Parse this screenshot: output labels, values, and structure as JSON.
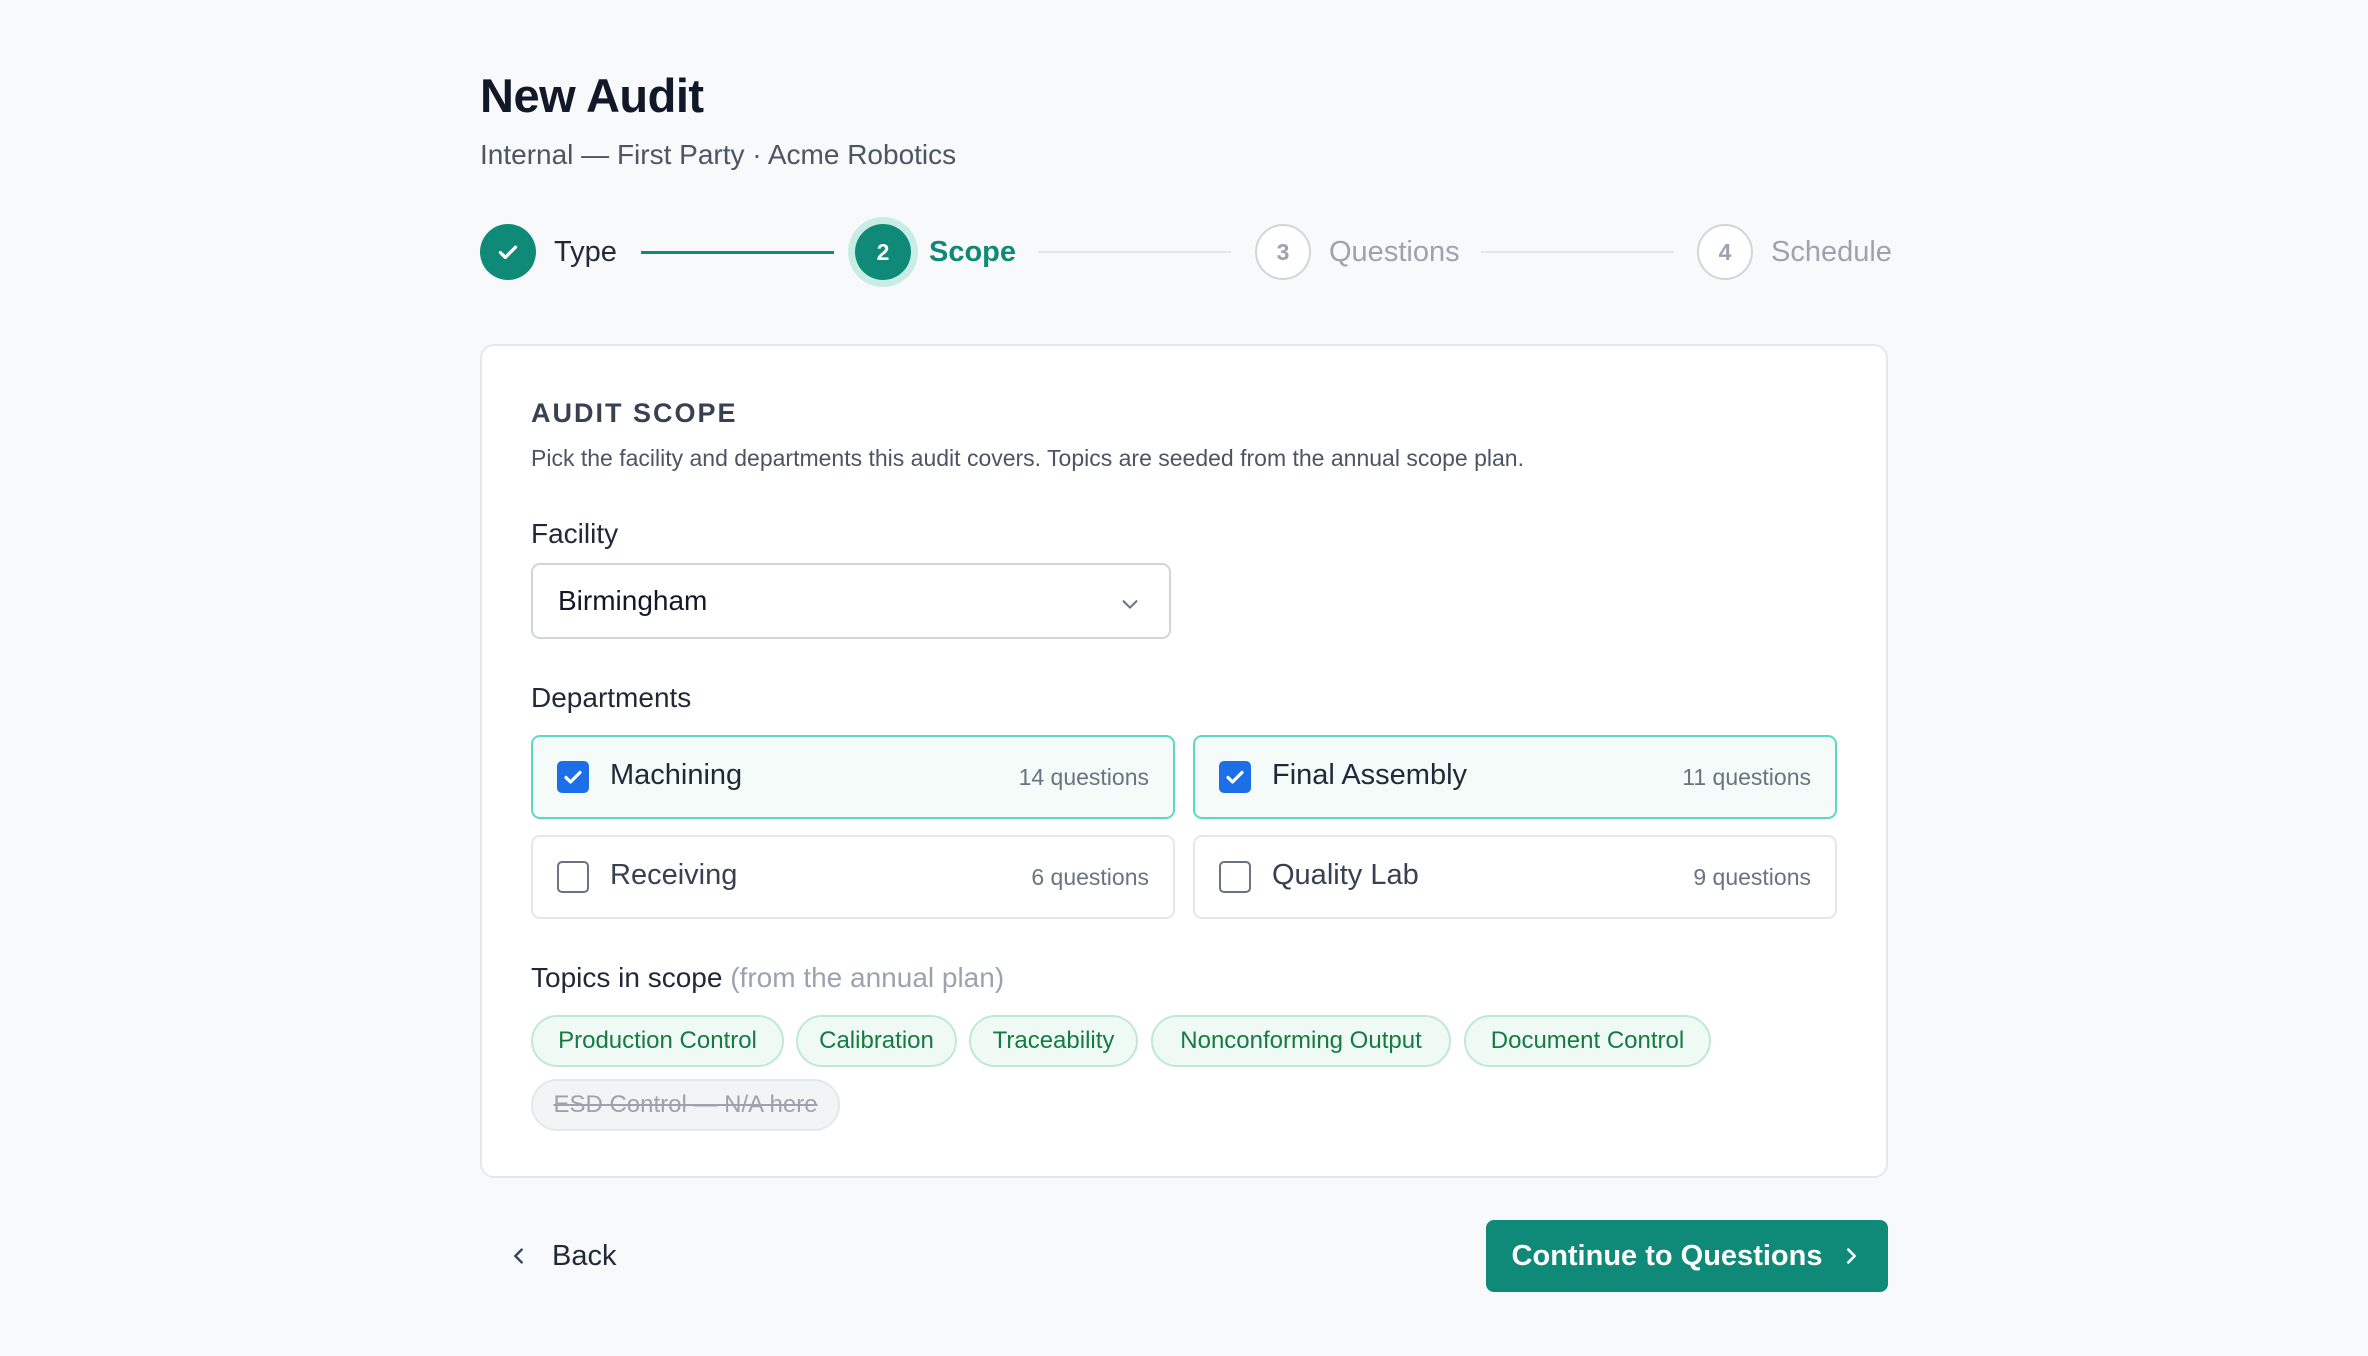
{
  "header": {
    "title": "New Audit",
    "subtitle": "Internal — First Party · Acme Robotics"
  },
  "stepper": {
    "steps": [
      {
        "number": "1",
        "label": "Type",
        "state": "complete"
      },
      {
        "number": "2",
        "label": "Scope",
        "state": "current"
      },
      {
        "number": "3",
        "label": "Questions",
        "state": "upcoming"
      },
      {
        "number": "4",
        "label": "Schedule",
        "state": "upcoming"
      }
    ]
  },
  "scope": {
    "title": "AUDIT SCOPE",
    "description": "Pick the facility and departments this audit covers. Topics are seeded from the annual scope plan.",
    "facility_label": "Facility",
    "facility_value": "Birmingham",
    "departments_label": "Departments",
    "departments": [
      {
        "name": "Machining",
        "count": "14 questions",
        "checked": true
      },
      {
        "name": "Final Assembly",
        "count": "11 questions",
        "checked": true
      },
      {
        "name": "Receiving",
        "count": "6 questions",
        "checked": false
      },
      {
        "name": "Quality Lab",
        "count": "9 questions",
        "checked": false
      }
    ],
    "topics_label": "Topics in scope",
    "topics_hint": "(from the annual plan)",
    "topics": [
      {
        "label": "Production Control",
        "applicable": true
      },
      {
        "label": "Calibration",
        "applicable": true
      },
      {
        "label": "Traceability",
        "applicable": true
      },
      {
        "label": "Nonconforming Output",
        "applicable": true
      },
      {
        "label": "Document Control",
        "applicable": true
      },
      {
        "label": "ESD Control — N/A here",
        "applicable": false
      }
    ]
  },
  "footer": {
    "back_label": "Back",
    "continue_label": "Continue to Questions"
  },
  "colors": {
    "accent": "#0f8a78",
    "checkbox": "#1d6fe8",
    "chip_text": "#157a45",
    "chip_bg": "#eefaf3"
  },
  "icons": {
    "step_complete": "check-icon",
    "facility_dropdown": "chevron-down-icon",
    "back": "chevron-left-icon",
    "continue": "chevron-right-icon"
  }
}
